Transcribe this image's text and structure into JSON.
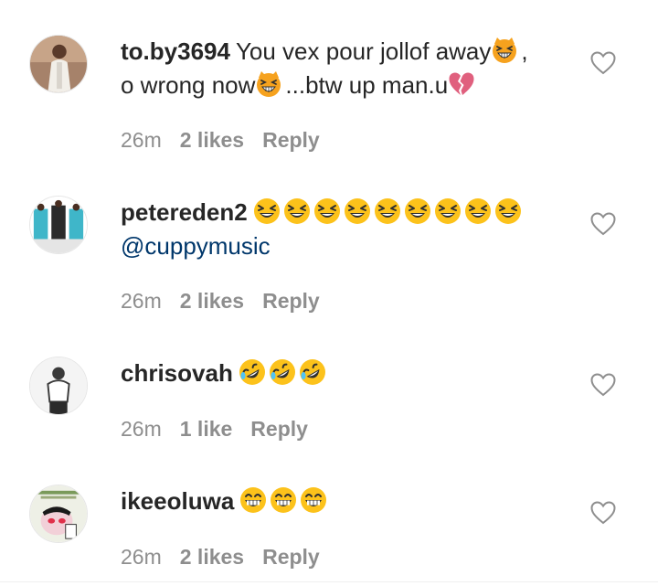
{
  "comments": [
    {
      "username": "to.by3694",
      "text_1": "You vex pour jollof away",
      "text_2": ",",
      "text_3": "o wrong now",
      "text_4": "...btw up man.u",
      "time": "26m",
      "likes": "2 likes",
      "reply": "Reply"
    },
    {
      "username": "petereden2",
      "mention": "@cuppymusic",
      "time": "26m",
      "likes": "2 likes",
      "reply": "Reply"
    },
    {
      "username": "chrisovah",
      "time": "26m",
      "likes": "1 like",
      "reply": "Reply"
    },
    {
      "username": "ikeeoluwa",
      "time": "26m",
      "likes": "2 likes",
      "reply": "Reply"
    }
  ],
  "colors": {
    "username": "#262626",
    "meta": "#8e8e8e",
    "mention": "#00376b",
    "emoji_yellow": "#fcc21b"
  },
  "icons": [
    "heart-outline-icon",
    "grinning-cat-emoji",
    "broken-heart-emoji",
    "grinning-squinting-emoji",
    "rolling-laughing-emoji",
    "grinning-smile-emoji"
  ]
}
